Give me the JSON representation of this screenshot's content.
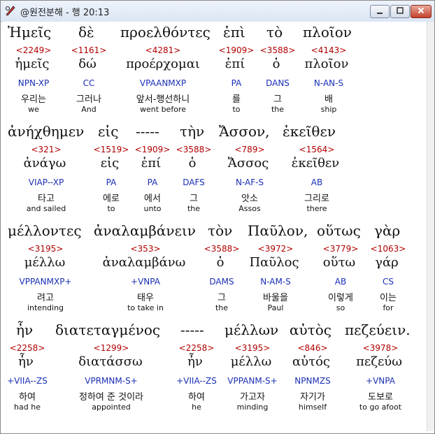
{
  "window": {
    "title": "@원전분해 - 행 20:13",
    "selected_word": "Ἡμεῖς"
  },
  "lines": [
    {
      "tokens": [
        {
          "greek": "Ἡμεῖς",
          "num": "<2249>",
          "lemma": "ἡμεῖς",
          "morph": "NPN-XP",
          "kor": "우리는",
          "eng": "we"
        },
        {
          "greek": "δὲ",
          "num": "<1161>",
          "lemma": "δώ",
          "morph": "CC",
          "kor": "그러나",
          "eng": "And"
        },
        {
          "greek": "προελθόντες",
          "num": "<4281>",
          "lemma": "προέρχομαι",
          "morph": "VPAANMXP",
          "kor": "앞서-행선하니",
          "eng": "went before"
        },
        {
          "greek": "ἐπὶ",
          "num": "<1909>",
          "lemma": "ἐπί",
          "morph": "PA",
          "kor": "를",
          "eng": "to"
        },
        {
          "greek": "τὸ",
          "num": "<3588>",
          "lemma": "ὁ",
          "morph": "DANS",
          "kor": "그",
          "eng": "the"
        },
        {
          "greek": "πλοῖον",
          "num": "<4143>",
          "lemma": "πλοῖον",
          "morph": "N-AN-S",
          "kor": "배",
          "eng": "ship"
        }
      ]
    },
    {
      "tokens": [
        {
          "greek": "ἀνήχθημεν",
          "num": "<321>",
          "lemma": "ἀνάγω",
          "morph": "VIAP--XP",
          "kor": "타고",
          "eng": "and sailed"
        },
        {
          "greek": "εἰς",
          "num": "<1519>",
          "lemma": "εἰς",
          "morph": "PA",
          "kor": "에로",
          "eng": "to"
        },
        {
          "greek": "-----",
          "num": "<1909>",
          "lemma": "ἐπί",
          "morph": "PA",
          "kor": "에서",
          "eng": "unto"
        },
        {
          "greek": "τὴν",
          "num": "<3588>",
          "lemma": "ὁ",
          "morph": "DAFS",
          "kor": "그",
          "eng": "the"
        },
        {
          "greek": "Ἄσσον,",
          "num": "<789>",
          "lemma": "Ἄσσος",
          "morph": "N-AF-S",
          "kor": "앗소",
          "eng": "Assos"
        },
        {
          "greek": "ἐκεῖθεν",
          "num": "<1564>",
          "lemma": "ἐκεῖθεν",
          "morph": "AB",
          "kor": "그리로",
          "eng": "there"
        }
      ]
    },
    {
      "tokens": [
        {
          "greek": "μέλλοντες",
          "num": "<3195>",
          "lemma": "μέλλω",
          "morph": "VPPANMXP+",
          "kor": "려고",
          "eng": "intending"
        },
        {
          "greek": "ἀναλαμβάνειν",
          "num": "<353>",
          "lemma": "ἀναλαμβάνω",
          "morph": "+VNPA",
          "kor": "태우",
          "eng": "to take in"
        },
        {
          "greek": "τὸν",
          "num": "<3588>",
          "lemma": "ὁ",
          "morph": "DAMS",
          "kor": "그",
          "eng": "the"
        },
        {
          "greek": "Παῦλον,",
          "num": "<3972>",
          "lemma": "Παῦλος",
          "morph": "N-AM-S",
          "kor": "바울을",
          "eng": "Paul"
        },
        {
          "greek": "οὕτως",
          "num": "<3779>",
          "lemma": "οὕτω",
          "morph": "AB",
          "kor": "이렇게",
          "eng": "so"
        },
        {
          "greek": "γὰρ",
          "num": "<1063>",
          "lemma": "γάρ",
          "morph": "CS",
          "kor": "이는",
          "eng": "for"
        }
      ]
    },
    {
      "tokens": [
        {
          "greek": "ἦν",
          "num": "<2258>",
          "lemma": "ἦν",
          "morph": "+VIIA--ZS",
          "kor": "하여",
          "eng": "had he"
        },
        {
          "greek": "διατεταγμένος",
          "num": "<1299>",
          "lemma": "διατάσσω",
          "morph": "VPRMNM-S+",
          "kor": "정하여 준 것이라",
          "eng": "appointed"
        },
        {
          "greek": "-----",
          "num": "<2258>",
          "lemma": "ἦν",
          "morph": "+VIIA--ZS",
          "kor": "하여",
          "eng": "he"
        },
        {
          "greek": "μέλλων",
          "num": "<3195>",
          "lemma": "μέλλω",
          "morph": "VPPANM-S+",
          "kor": "가고자",
          "eng": "minding"
        },
        {
          "greek": "αὐτὸς",
          "num": "<846>",
          "lemma": "αὐτός",
          "morph": "NPNMZS",
          "kor": "자기가",
          "eng": "himself"
        },
        {
          "greek": "πεζεύειν.",
          "num": "<3978>",
          "lemma": "πεζεύω",
          "morph": "+VNPA",
          "kor": "도보로",
          "eng": "to go afoot"
        }
      ]
    }
  ]
}
